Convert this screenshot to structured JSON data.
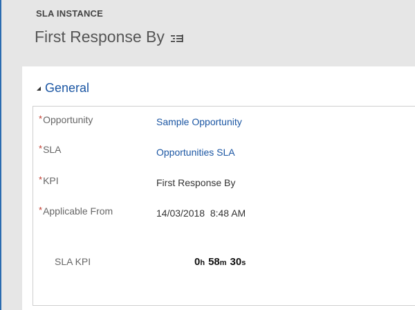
{
  "header": {
    "entity_type": "SLA INSTANCE",
    "record_title": "First Response By",
    "menu_icon": "menu-lines-icon"
  },
  "section": {
    "title": "General",
    "collapse_icon": "triangle-collapse-icon"
  },
  "fields": {
    "opportunity": {
      "label": "Opportunity",
      "value": "Sample Opportunity",
      "required": true
    },
    "sla": {
      "label": "SLA",
      "value": "Opportunities SLA",
      "required": true
    },
    "kpi": {
      "label": "KPI",
      "value": "First Response By",
      "required": true
    },
    "applicable_from": {
      "label": "Applicable From",
      "value": "14/03/2018  8:48 AM",
      "required": true
    },
    "sla_kpi": {
      "label": "SLA KPI",
      "hours": "0",
      "hours_unit": "h",
      "minutes": "58",
      "minutes_unit": "m",
      "seconds": "30",
      "seconds_unit": "s"
    }
  },
  "required_marker": "*",
  "colors": {
    "link": "#1b56a3",
    "required": "#c0392b",
    "header_bg": "#e6e6e6",
    "accent_rule": "#2b6cb0"
  }
}
